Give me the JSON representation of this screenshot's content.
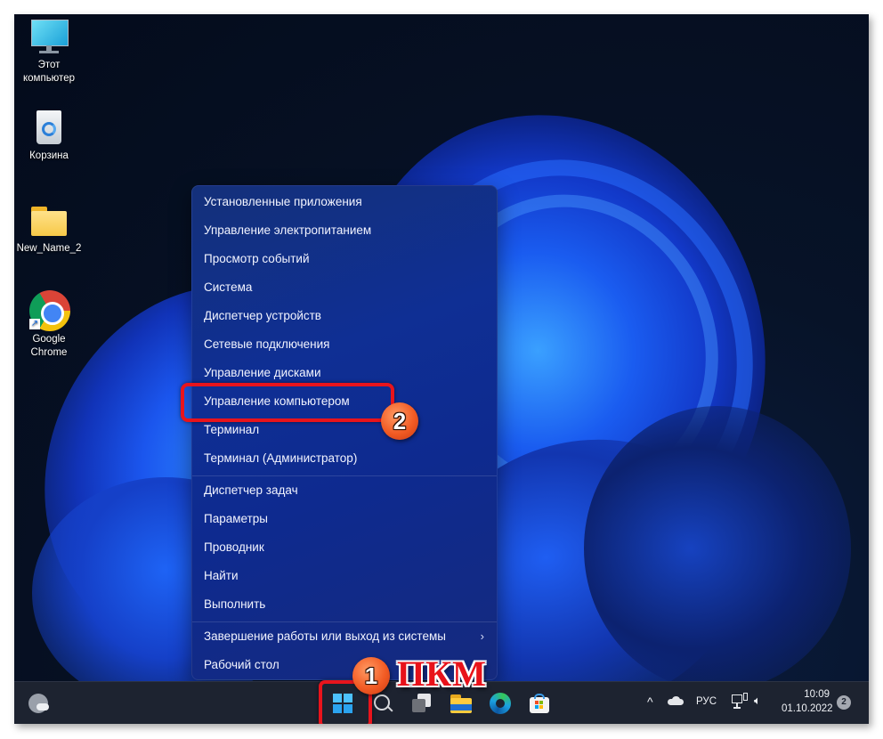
{
  "desktop": {
    "icons": [
      {
        "label": "Этот компьютер",
        "icon": "monitor-icon"
      },
      {
        "label": "Корзина",
        "icon": "recycle-bin-icon"
      },
      {
        "label": "New_Name_2",
        "icon": "folder-icon"
      },
      {
        "label": "Google Chrome",
        "icon": "chrome-icon"
      }
    ]
  },
  "context_menu": {
    "items": [
      {
        "label": "Установленные приложения"
      },
      {
        "label": "Управление электропитанием"
      },
      {
        "label": "Просмотр событий"
      },
      {
        "label": "Система"
      },
      {
        "label": "Диспетчер устройств"
      },
      {
        "label": "Сетевые подключения"
      },
      {
        "label": "Управление дисками"
      },
      {
        "label": "Управление компьютером",
        "highlighted": true
      },
      {
        "label": "Терминал"
      },
      {
        "label": "Терминал (Администратор)"
      },
      {
        "label": "Диспетчер задач"
      },
      {
        "label": "Параметры"
      },
      {
        "label": "Проводник"
      },
      {
        "label": "Найти"
      },
      {
        "label": "Выполнить"
      },
      {
        "label": "Завершение работы или выход из системы",
        "submenu": true
      },
      {
        "label": "Рабочий стол"
      }
    ],
    "submenu_glyph": "›"
  },
  "annotations": {
    "step1": "1",
    "step2": "2",
    "step1_caption": "ПКМ",
    "highlight_color": "#e8141c",
    "badge_color": "#f25b24"
  },
  "taskbar": {
    "weather_icon": "weather-icon",
    "pinned": [
      "start-icon",
      "search-icon",
      "task-view-icon",
      "file-explorer-icon",
      "edge-icon",
      "store-icon"
    ],
    "tray": {
      "overflow_glyph": "^",
      "language": "РУС",
      "time": "10:09",
      "date": "01.10.2022",
      "notifications": "2"
    }
  }
}
